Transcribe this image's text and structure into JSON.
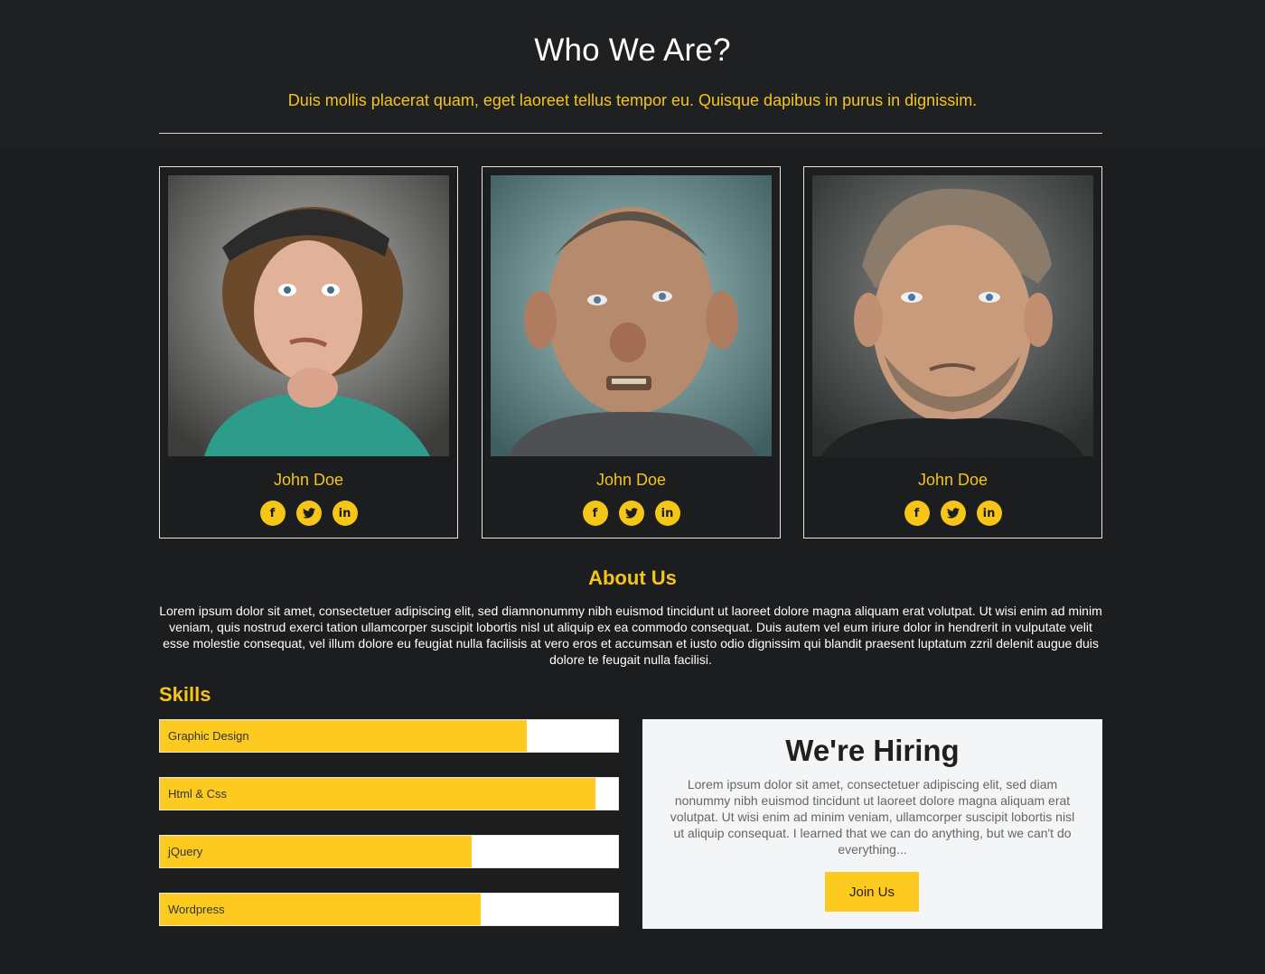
{
  "header": {
    "title": "Who We Are?",
    "subtitle": "Duis mollis placerat quam, eget laoreet tellus tempor eu. Quisque dapibus in purus in dignissim."
  },
  "team": [
    {
      "name": "John Doe",
      "socials": [
        "facebook-icon",
        "twitter-icon",
        "linkedin-icon"
      ]
    },
    {
      "name": "John Doe",
      "socials": [
        "facebook-icon",
        "twitter-icon",
        "linkedin-icon"
      ]
    },
    {
      "name": "John Doe",
      "socials": [
        "facebook-icon",
        "twitter-icon",
        "linkedin-icon"
      ]
    }
  ],
  "social_glyphs": {
    "facebook": "f",
    "twitter": "🐦",
    "linkedin": "in"
  },
  "about": {
    "title": "About Us",
    "text": "Lorem ipsum dolor sit amet, consectetuer adipiscing elit, sed diamnonummy nibh euismod tincidunt ut laoreet dolore magna aliquam erat volutpat. Ut wisi enim ad minim veniam, quis nostrud exerci tation ullamcorper suscipit lobortis nisl ut aliquip ex ea commodo consequat. Duis autem vel eum iriure dolor in hendrerit in vulputate velit esse molestie consequat, vel illum dolore eu feugiat nulla facilisis at vero eros et accumsan et iusto odio dignissim qui blandit praesent luptatum zzril delenit augue duis dolore te feugait nulla facilisi."
  },
  "skills": {
    "title": "Skills",
    "items": [
      {
        "label": "Graphic Design",
        "percent": 80
      },
      {
        "label": "Html & Css",
        "percent": 95
      },
      {
        "label": "jQuery",
        "percent": 68
      },
      {
        "label": "Wordpress",
        "percent": 70
      }
    ]
  },
  "hiring": {
    "title": "We're Hiring",
    "text": "Lorem ipsum dolor sit amet, consectetuer adipiscing elit, sed diam nonummy nibh euismod tincidunt ut laoreet dolore magna aliquam erat volutpat. Ut wisi enim ad minim veniam, ullamcorper suscipit lobortis nisl ut aliquip consequat. I learned that we can do anything, but we can't do everything...",
    "button_label": "Join Us"
  },
  "colors": {
    "background": "#1c1d1f",
    "accent": "#fdcb1f",
    "panel": "#f3f5f6"
  }
}
